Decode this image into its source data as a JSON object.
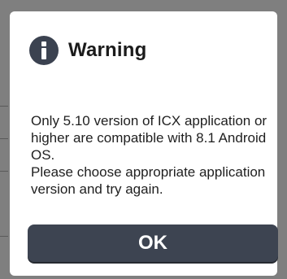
{
  "dialog": {
    "icon": "info-icon",
    "title": "Warning",
    "message_line_1": "Only 5.10 version of ICX application or higher are compatible with 8.1 Android OS.",
    "message_line_2": "Please choose appropriate application version and try again.",
    "ok_label": "OK"
  },
  "colors": {
    "button_bg": "#3d4451",
    "icon_bg": "#3b4250",
    "dialog_bg": "#ffffff",
    "overlay": "#7f7f7f"
  }
}
